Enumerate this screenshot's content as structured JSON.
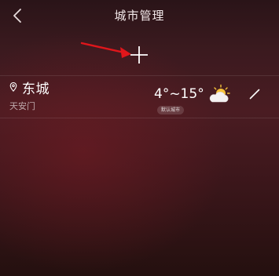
{
  "header": {
    "title": "城市管理",
    "back_icon": "chevron-left-icon"
  },
  "add_city": {
    "icon": "plus-icon"
  },
  "annotation": {
    "arrow_color": "#e0161b"
  },
  "city_card": {
    "city": "东城",
    "district": "天安门",
    "temperature_range": "4°~15°",
    "default_badge": "默认城市",
    "weather_icon": "partly-cloudy-icon",
    "edit_icon": "pencil-icon",
    "location_icon": "pin-icon"
  },
  "colors": {
    "background_top": "#2a1418",
    "background_mid": "#4a1c22",
    "background_bottom": "#24100f",
    "text_primary": "#ffffff",
    "sun": "#f6c23a"
  }
}
